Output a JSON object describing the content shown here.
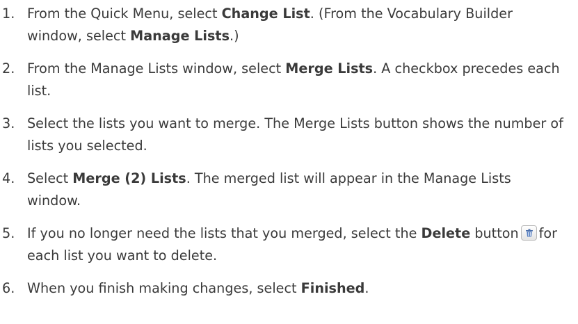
{
  "steps": [
    {
      "num": "1.",
      "parts": [
        {
          "t": "From the Quick Menu, select "
        },
        {
          "t": "Change List",
          "b": true
        },
        {
          "t": ". (From the Vocabulary Builder window, select "
        },
        {
          "t": "Manage Lists",
          "b": true
        },
        {
          "t": ".)"
        }
      ]
    },
    {
      "num": "2.",
      "parts": [
        {
          "t": "From the Manage Lists window, select "
        },
        {
          "t": "Merge Lists",
          "b": true
        },
        {
          "t": ". A checkbox precedes each list."
        }
      ]
    },
    {
      "num": "3.",
      "parts": [
        {
          "t": "Select the lists you want to merge. The Merge Lists button shows the number of lists you selected."
        }
      ]
    },
    {
      "num": "4.",
      "parts": [
        {
          "t": "Select "
        },
        {
          "t": "Merge (2) Lists",
          "b": true
        },
        {
          "t": ". The merged list will appear in the Manage Lists window."
        }
      ]
    },
    {
      "num": "5.",
      "parts": [
        {
          "t": "If you no longer need the lists that you merged, select the "
        },
        {
          "t": "Delete",
          "b": true
        },
        {
          "t": " button"
        },
        {
          "icon": "trash-icon"
        },
        {
          "t": "for each list you want to delete."
        }
      ]
    },
    {
      "num": "6.",
      "parts": [
        {
          "t": "When you finish making changes, select "
        },
        {
          "t": "Finished",
          "b": true
        },
        {
          "t": "."
        }
      ]
    }
  ]
}
